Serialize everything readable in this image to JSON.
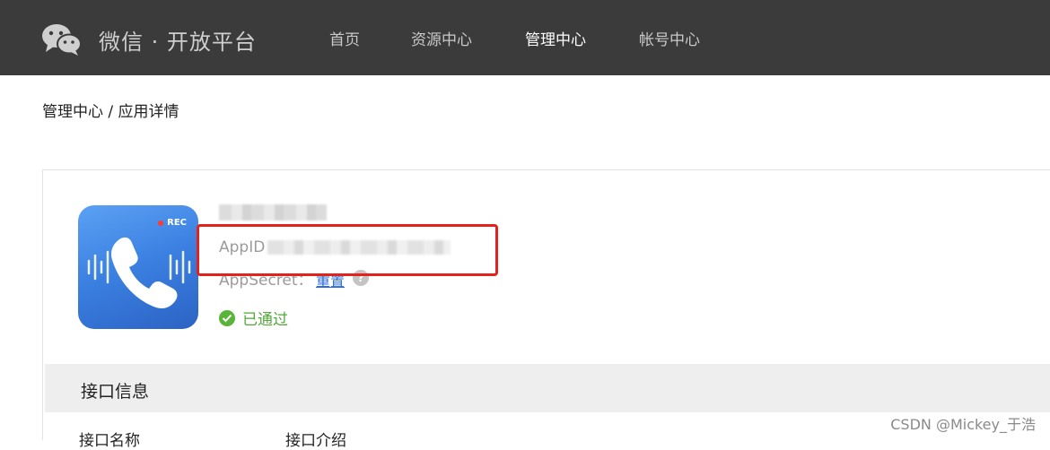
{
  "header": {
    "brand_title": "微信 · 开放平台",
    "nav": [
      {
        "label": "首页",
        "active": false
      },
      {
        "label": "资源中心",
        "active": false
      },
      {
        "label": "管理中心",
        "active": true
      },
      {
        "label": "帐号中心",
        "active": false
      }
    ],
    "colors": {
      "bar": "#3b3b3b",
      "nav_text": "#c9c9c9",
      "nav_active": "#ffffff"
    }
  },
  "breadcrumb": "管理中心 / 应用详情",
  "app": {
    "icon_name": "phone-recorder-icon",
    "icon_badge": "REC",
    "appid_label": "AppID",
    "appsecret_label": "AppSecret：",
    "reset_link": "重置",
    "help_icon": "help-icon",
    "status": "已通过",
    "colors": {
      "link": "#2a6bd6",
      "status": "#52a83b",
      "highlight": "#e4221d"
    }
  },
  "interface_section": {
    "title": "接口信息",
    "columns": [
      "接口名称",
      "接口介绍"
    ]
  },
  "watermark": "CSDN @Mickey_于浩"
}
